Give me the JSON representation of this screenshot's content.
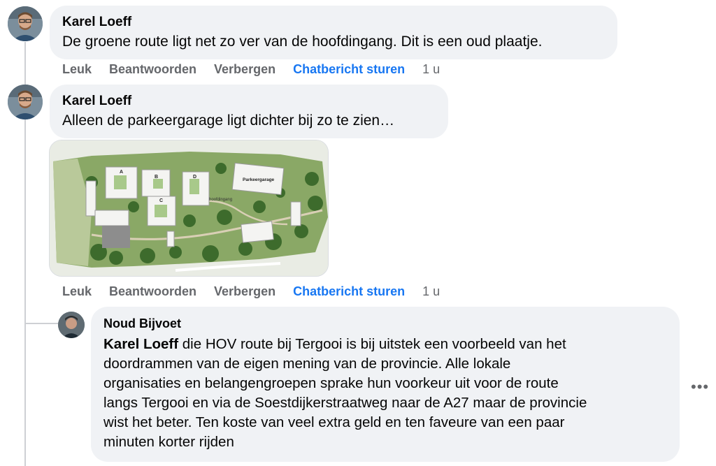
{
  "comments": [
    {
      "author": "Karel Loeff",
      "text": "De groene route ligt net zo ver van de hoofdingang. Dit is een oud plaatje.",
      "actions": {
        "like": "Leuk",
        "reply": "Beantwoorden",
        "hide": "Verbergen",
        "message": "Chatbericht sturen",
        "time": "1 u"
      }
    },
    {
      "author": "Karel Loeff",
      "text": "Alleen de parkeergarage ligt dichter bij zo te zien…",
      "image_labels": {
        "garage": "Parkeergarage",
        "entrance": "hoofdingang",
        "a": "A",
        "b": "B",
        "c": "C",
        "d": "D"
      },
      "actions": {
        "like": "Leuk",
        "reply": "Beantwoorden",
        "hide": "Verbergen",
        "message": "Chatbericht sturen",
        "time": "1 u"
      }
    }
  ],
  "reply": {
    "author": "Noud Bijvoet",
    "mention": "Karel Loeff",
    "lines": [
      " die HOV route bij Tergooi is bij uitstek een voorbeeld van het",
      "doordrammen van de eigen mening van de provincie. Alle lokale",
      "organisaties en belangengroepen sprake hun voorkeur uit voor de route",
      "langs Tergooi en via de Soestdijkerstraatweg naar de A27 maar de provincie",
      "wist het beter. Ten koste van veel extra geld en ten faveure van een paar",
      "minuten korter rijden"
    ],
    "more_icon": "•••"
  },
  "colors": {
    "bubble": "#f0f2f5",
    "action": "#65676b",
    "link": "#1877f2"
  }
}
